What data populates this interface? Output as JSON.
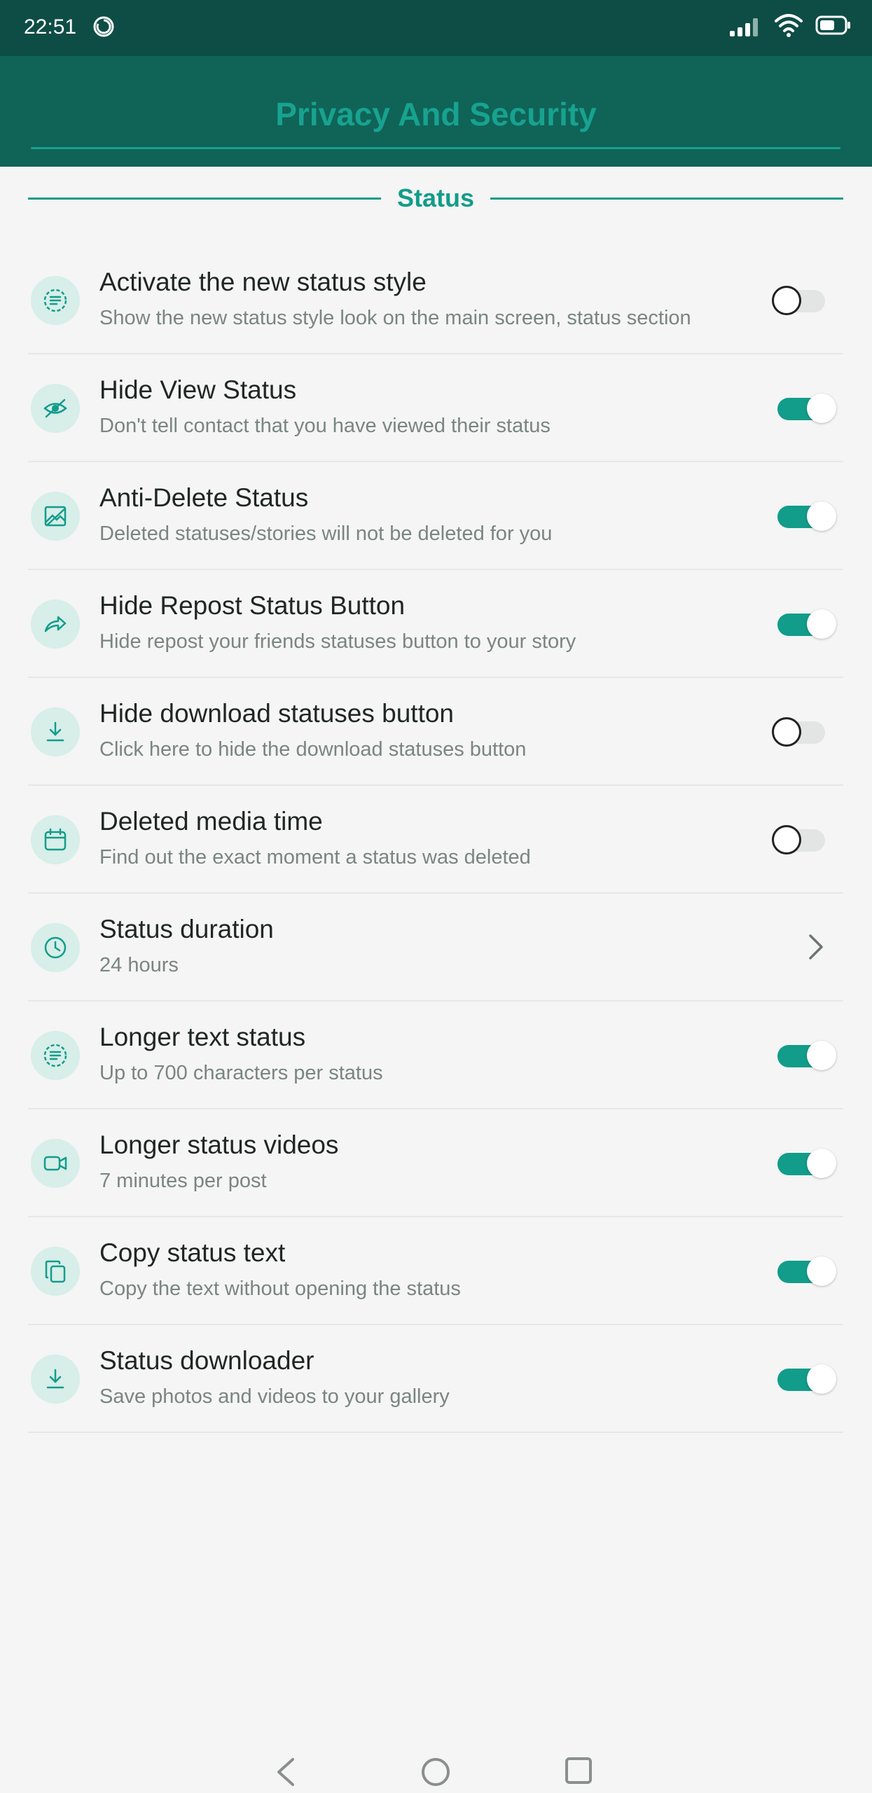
{
  "status_bar": {
    "time": "22:51",
    "icons": [
      "sync-icon",
      "signal-icon",
      "wifi-icon",
      "battery-icon"
    ]
  },
  "header": {
    "title": "Privacy And Security"
  },
  "section": {
    "label": "Status"
  },
  "colors": {
    "accent": "#129c8a",
    "header_bg": "#0f6457",
    "status_bar_bg": "#0e4d45",
    "icon_bg": "#d7eee9"
  },
  "settings": [
    {
      "title": "Activate the new status style",
      "subtitle": "Show the new status style look on the main screen, status section",
      "icon": "dashed-circle-icon",
      "control": "toggle",
      "enabled": false
    },
    {
      "title": "Hide View Status",
      "subtitle": "Don't tell contact that you have viewed their status",
      "icon": "eye-off-icon",
      "control": "toggle",
      "enabled": true
    },
    {
      "title": "Anti-Delete Status",
      "subtitle": "Deleted statuses/stories will not be deleted for you",
      "icon": "image-icon",
      "control": "toggle",
      "enabled": true
    },
    {
      "title": "Hide Repost Status Button",
      "subtitle": "Hide repost your friends statuses button to your story",
      "icon": "share-arrow-icon",
      "control": "toggle",
      "enabled": true
    },
    {
      "title": "Hide download statuses button",
      "subtitle": "Click here to hide the download statuses button",
      "icon": "download-icon",
      "control": "toggle",
      "enabled": false
    },
    {
      "title": "Deleted media time",
      "subtitle": "Find out the exact moment a status was deleted",
      "icon": "calendar-icon",
      "control": "toggle",
      "enabled": false
    },
    {
      "title": "Status duration",
      "subtitle": "24 hours",
      "icon": "clock-icon",
      "control": "chevron"
    },
    {
      "title": "Longer text status",
      "subtitle": "Up to 700 characters per status",
      "icon": "dashed-circle-icon",
      "control": "toggle",
      "enabled": true
    },
    {
      "title": "Longer status videos",
      "subtitle": "7 minutes per post",
      "icon": "video-icon",
      "control": "toggle",
      "enabled": true
    },
    {
      "title": "Copy status text",
      "subtitle": "Copy the text without opening the status",
      "icon": "copy-icon",
      "control": "toggle",
      "enabled": true
    },
    {
      "title": "Status downloader",
      "subtitle": "Save photos and videos to your gallery",
      "icon": "download-icon",
      "control": "toggle",
      "enabled": true
    }
  ],
  "nav_bar": {
    "buttons": [
      "back-icon",
      "home-icon",
      "recents-icon"
    ]
  }
}
